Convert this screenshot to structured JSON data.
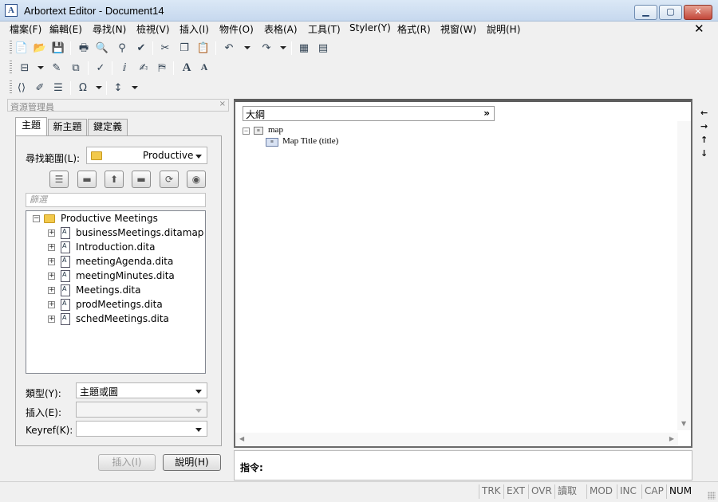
{
  "window": {
    "title": "Arbortext Editor - Document14",
    "app_icon_glyph": "A"
  },
  "menu": {
    "items": [
      "檔案(F)",
      "編輯(E)",
      "尋找(N)",
      "檢視(V)",
      "插入(I)",
      "物件(O)",
      "表格(A)",
      "工具(T)",
      "Styler(Y)",
      "格式(R)",
      "視窗(W)",
      "說明(H)"
    ],
    "close_glyph": "✕"
  },
  "resource_panel": {
    "title": "資源管理員",
    "close_glyph": "×",
    "tabs": [
      "主題",
      "新主題",
      "鍵定義"
    ],
    "active_tab": 0,
    "search_scope_label": "尋找範圍(L):",
    "search_scope_value": "Productive",
    "filter_placeholder": "篩選",
    "tree": {
      "root": "Productive Meetings",
      "items": [
        "businessMeetings.ditamap",
        "Introduction.dita",
        "meetingAgenda.dita",
        "meetingMinutes.dita",
        "Meetings.dita",
        "prodMeetings.dita",
        "schedMeetings.dita"
      ]
    },
    "type_label": "類型(Y):",
    "type_value": "主題或圖",
    "insert_label": "插入(E):",
    "insert_value": "",
    "keyref_label": "Keyref(K):",
    "keyref_value": "",
    "insert_button": "插入(I)",
    "help_button": "說明(H)"
  },
  "editor": {
    "outline_label": "大綱",
    "outline_more": "»",
    "nodes": {
      "map": "map",
      "title": "Map Title (title)"
    }
  },
  "command": {
    "label": "指令:"
  },
  "status": {
    "cells": [
      "TRK",
      "EXT",
      "OVR",
      "讀取",
      "MOD",
      "INC",
      "CAP",
      "NUM"
    ],
    "active": [
      "NUM"
    ]
  }
}
